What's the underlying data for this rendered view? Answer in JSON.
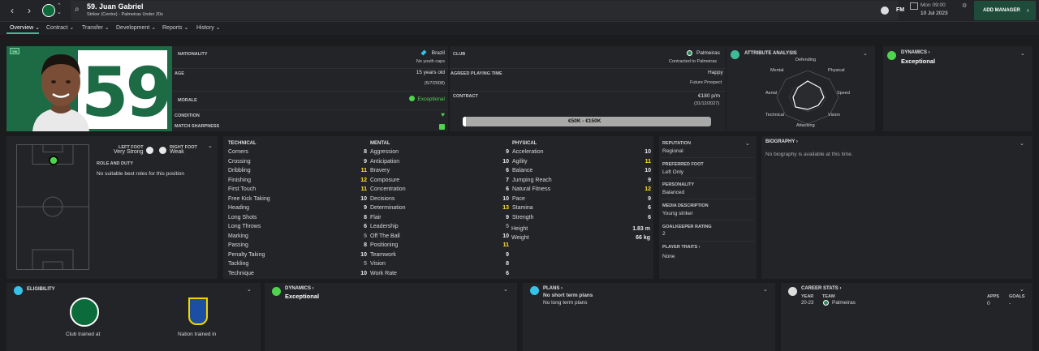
{
  "header": {
    "title": "59. Juan Gabriel",
    "subtitle": "Striker (Centre) - Palmeiras Under 20s",
    "fm": "FM",
    "time": "Mon 09:00",
    "date": "10 Jul 2023",
    "add_manager": "ADD MANAGER"
  },
  "tabs": [
    "Overview",
    "Contract",
    "Transfer",
    "Development",
    "Reports",
    "History"
  ],
  "hero": {
    "badge": "Yth",
    "name": "JUAN GABRIEL",
    "number": "59"
  },
  "info": {
    "nationality_label": "NATIONALITY",
    "nationality": "Brazil",
    "youth_caps": "No youth caps",
    "age_label": "AGE",
    "age": "15 years old",
    "dob": "(5/7/2008)",
    "morale_label": "MORALE",
    "morale": "Exceptional",
    "condition_label": "CONDITION",
    "sharpness_label": "MATCH SHARPNESS",
    "club_label": "CLUB",
    "club": "Palmeiras",
    "contracted": "Contracted to Palmeiras",
    "apt_label": "AGREED PLAYING TIME",
    "apt": "Happy",
    "apt_sub": "Future Prospect",
    "contract_label": "CONTRACT",
    "wage": "€180 p/m",
    "expiry": "(31/12/2027)",
    "value": "€50K - €150K"
  },
  "attr_analysis": {
    "title": "ATTRIBUTE ANALYSIS",
    "labels": [
      "Defending",
      "Physical",
      "Speed",
      "Vision",
      "Attacking",
      "Technical",
      "Aerial",
      "Mental"
    ]
  },
  "dynamics": {
    "title": "DYNAMICS",
    "value": "Exceptional"
  },
  "pitch": {
    "left_foot_label": "LEFT FOOT",
    "left_foot": "Very Strong",
    "right_foot_label": "RIGHT FOOT",
    "right_foot": "Weak",
    "role_title": "ROLE AND DUTY",
    "role_text": "No suitable best roles for this position"
  },
  "technical": {
    "title": "TECHNICAL",
    "items": [
      [
        "Corners",
        "8"
      ],
      [
        "Crossing",
        "9"
      ],
      [
        "Dribbling",
        "11"
      ],
      [
        "Finishing",
        "12"
      ],
      [
        "First Touch",
        "11"
      ],
      [
        "Free Kick Taking",
        "10"
      ],
      [
        "Heading",
        "9"
      ],
      [
        "Long Shots",
        "8"
      ],
      [
        "Long Throws",
        "6"
      ],
      [
        "Marking",
        "5"
      ],
      [
        "Passing",
        "8"
      ],
      [
        "Penalty Taking",
        "10"
      ],
      [
        "Tackling",
        "5"
      ],
      [
        "Technique",
        "10"
      ]
    ]
  },
  "mental": {
    "title": "MENTAL",
    "items": [
      [
        "Aggression",
        "9"
      ],
      [
        "Anticipation",
        "10"
      ],
      [
        "Bravery",
        "6"
      ],
      [
        "Composure",
        "7"
      ],
      [
        "Concentration",
        "6"
      ],
      [
        "Decisions",
        "10"
      ],
      [
        "Determination",
        "13"
      ],
      [
        "Flair",
        "9"
      ],
      [
        "Leadership",
        "5"
      ],
      [
        "Off The Ball",
        "10"
      ],
      [
        "Positioning",
        "11"
      ],
      [
        "Teamwork",
        "9"
      ],
      [
        "Vision",
        "8"
      ],
      [
        "Work Rate",
        "6"
      ]
    ]
  },
  "physical": {
    "title": "PHYSICAL",
    "items": [
      [
        "Acceleration",
        "10"
      ],
      [
        "Agility",
        "11"
      ],
      [
        "Balance",
        "10"
      ],
      [
        "Jumping Reach",
        "9"
      ],
      [
        "Natural Fitness",
        "12"
      ],
      [
        "Pace",
        "9"
      ],
      [
        "Stamina",
        "6"
      ],
      [
        "Strength",
        "6"
      ]
    ],
    "height_label": "Height",
    "height": "1.83 m",
    "weight_label": "Weight",
    "weight": "66 kg"
  },
  "profile": {
    "reputation_label": "REPUTATION",
    "reputation": "Regional",
    "pref_foot_label": "PREFERRED FOOT",
    "pref_foot": "Left Only",
    "personality_label": "PERSONALITY",
    "personality": "Balanced",
    "media_label": "MEDIA DESCRIPTION",
    "media": "Young striker",
    "gk_label": "GOALKEEPER RATING",
    "gk": "2",
    "traits_label": "PLAYER TRAITS",
    "traits": "None"
  },
  "biography": {
    "title": "BIOGRAPHY",
    "text": "No biography is available at this time."
  },
  "eligibility": {
    "title": "ELIGIBILITY",
    "club_trained": "Club trained at",
    "nation_trained": "Nation trained in"
  },
  "plans": {
    "title": "PLANS",
    "short": "No short term plans",
    "long": "No long term plans"
  },
  "career": {
    "title": "CAREER STATS",
    "year_h": "YEAR",
    "team_h": "TEAM",
    "apps_h": "APPS",
    "goals_h": "GOALS",
    "year": "20-23",
    "team": "Palmeiras",
    "apps": "0",
    "goals": "-"
  }
}
